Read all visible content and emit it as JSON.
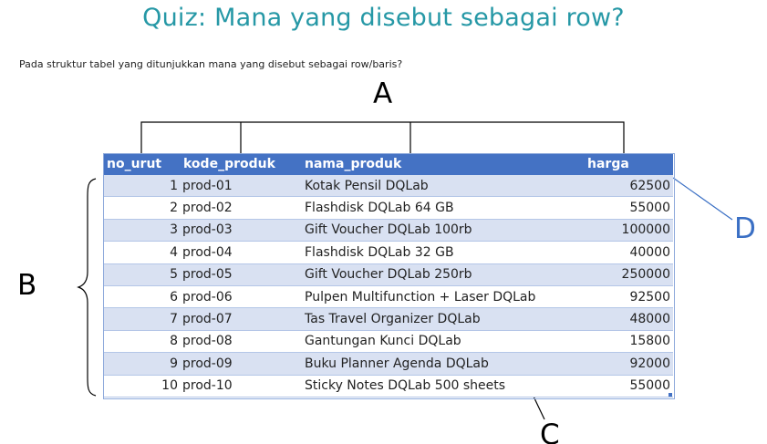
{
  "title": "Quiz: Mana yang disebut sebagai row?",
  "question": "Pada struktur tabel yang ditunjukkan mana yang disebut sebagai row/baris?",
  "labels": {
    "a": "A",
    "b": "B",
    "c": "C",
    "d": "D"
  },
  "colors": {
    "title": "#2698a6",
    "header": "#4472c4",
    "band": "#d9e1f2",
    "pointer_d": "#3a6fc4"
  },
  "table": {
    "columns": [
      "no_urut",
      "kode_produk",
      "nama_produk",
      "harga"
    ],
    "rows": [
      [
        "1",
        "prod-01",
        "Kotak Pensil DQLab",
        "62500"
      ],
      [
        "2",
        "prod-02",
        "Flashdisk DQLab 64 GB",
        "55000"
      ],
      [
        "3",
        "prod-03",
        "Gift Voucher DQLab 100rb",
        "100000"
      ],
      [
        "4",
        "prod-04",
        "Flashdisk DQLab 32 GB",
        "40000"
      ],
      [
        "5",
        "prod-05",
        "Gift Voucher DQLab 250rb",
        "250000"
      ],
      [
        "6",
        "prod-06",
        "Pulpen Multifunction + Laser DQLab",
        "92500"
      ],
      [
        "7",
        "prod-07",
        "Tas Travel Organizer DQLab",
        "48000"
      ],
      [
        "8",
        "prod-08",
        "Gantungan Kunci DQLab",
        "15800"
      ],
      [
        "9",
        "prod-09",
        "Buku Planner Agenda DQLab",
        "92000"
      ],
      [
        "10",
        "prod-10",
        "Sticky Notes DQLab 500 sheets",
        "55000"
      ]
    ]
  }
}
